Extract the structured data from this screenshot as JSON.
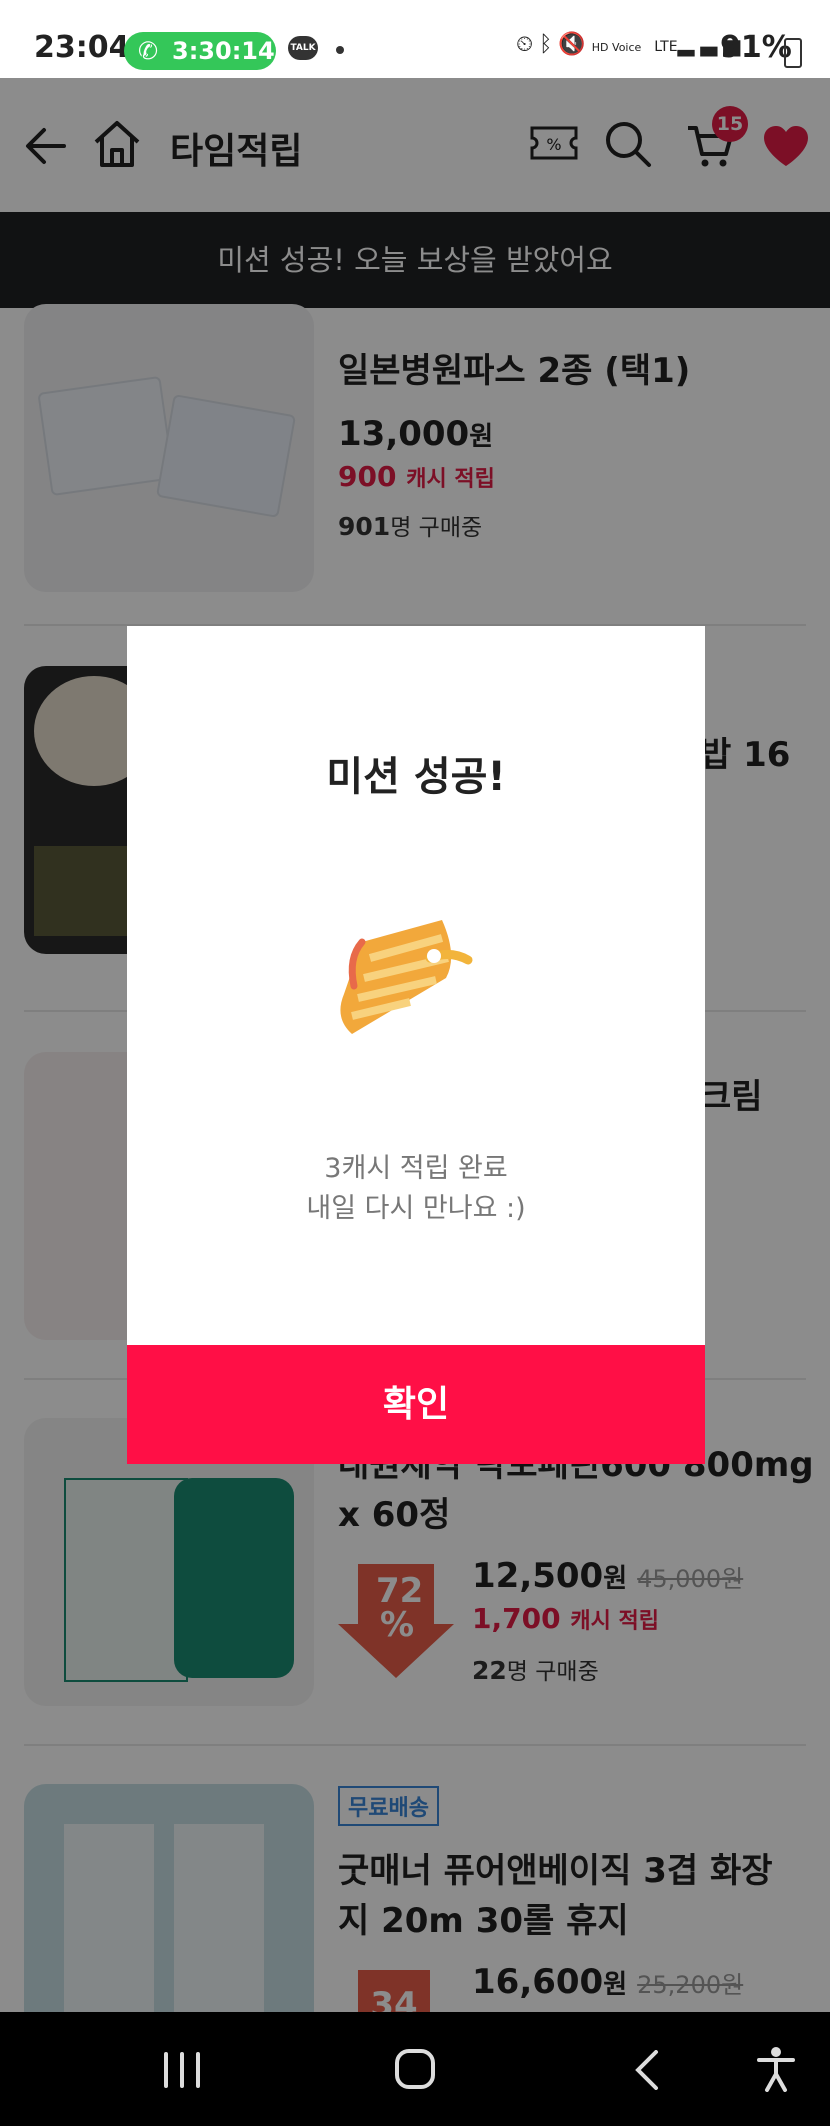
{
  "status_bar": {
    "time": "23:04",
    "call_timer": "3:30:14",
    "talk_label": "TALK",
    "hd_voice": "HD Voice",
    "network": "LTE",
    "battery": "91%"
  },
  "header": {
    "title": "타임적립",
    "cart_count": "15"
  },
  "banner": {
    "text": "미션 성공! 오늘 보상을 받았어요"
  },
  "products": [
    {
      "title": "일본병원파스 2종 (택1)",
      "price": "13,000",
      "won": "원",
      "cash": "900",
      "cash_label": "캐시 적립",
      "buyers": "901",
      "buyers_label": "명 구매중"
    },
    {
      "title_tail": "밥 16"
    },
    {
      "title_tail": "크림"
    },
    {
      "title_line1": "대원제약 락토페린600 800mg",
      "title_line2": "x 60정",
      "discount": "72",
      "discount_unit": "%",
      "price": "12,500",
      "won": "원",
      "old_price": "45,000원",
      "cash": "1,700",
      "cash_label": "캐시 적립",
      "buyers": "22",
      "buyers_label": "명 구매중"
    },
    {
      "badge": "무료배송",
      "title_line1": "굿매너 퓨어앤베이직 3겹 화장",
      "title_line2": "지 20m 30롤 휴지",
      "discount": "34",
      "price": "16,600",
      "won": "원",
      "old_price": "25,200원"
    }
  ],
  "modal": {
    "title": "미션 성공!",
    "message_line1": "3캐시 적립 완료",
    "message_line2": "내일 다시 만나요 :)",
    "confirm_label": "확인"
  },
  "colors": {
    "accent": "#ff0f46",
    "cash": "#e21c46",
    "banner_bg": "#202224"
  }
}
